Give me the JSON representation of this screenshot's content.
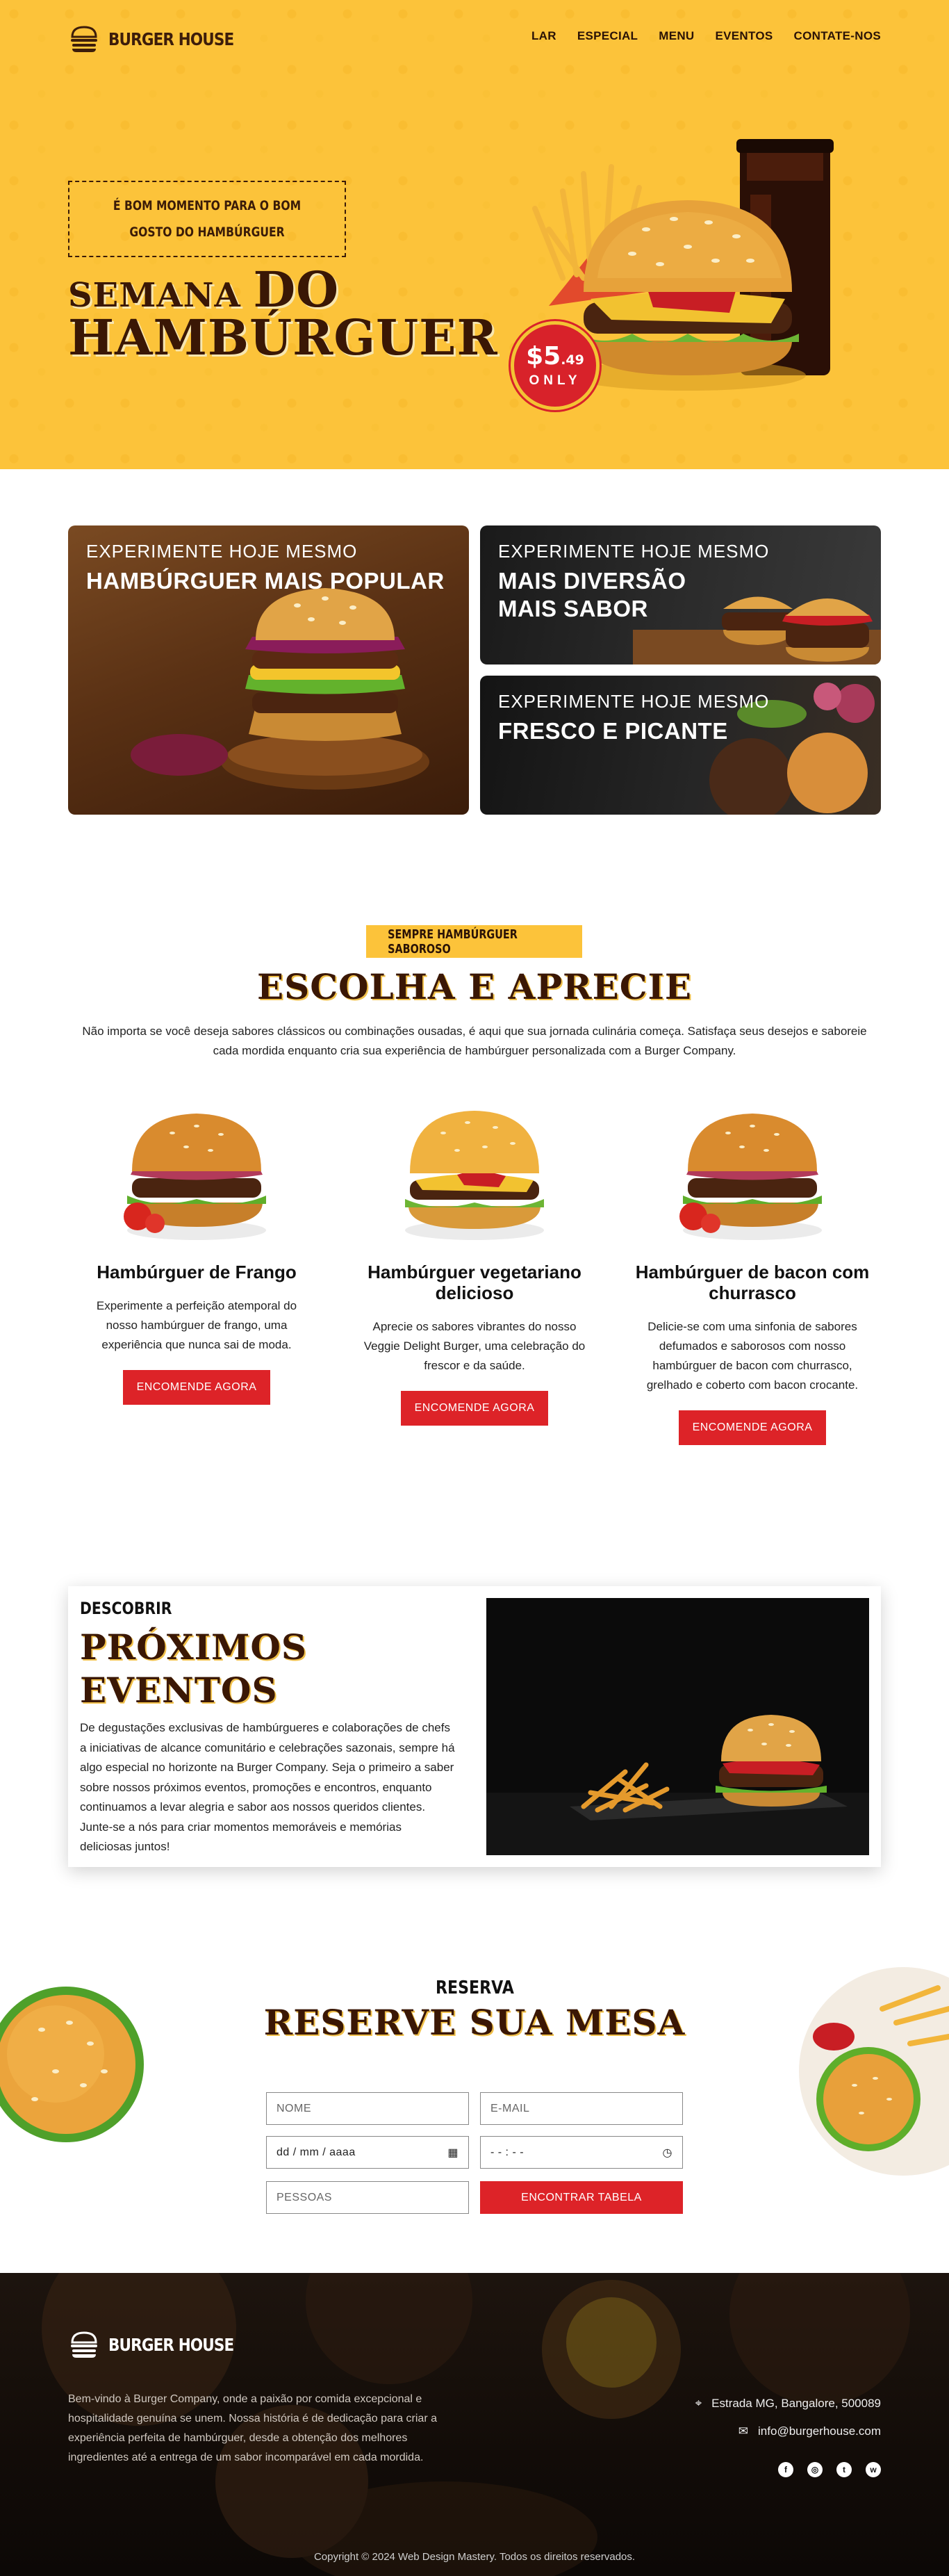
{
  "brand": {
    "name": "BURGER HOUSE"
  },
  "nav": {
    "items": [
      "LAR",
      "ESPECIAL",
      "MENU",
      "EVENTOS",
      "CONTATE-NOS"
    ]
  },
  "hero": {
    "tagline": "É BOM MOMENTO PARA O BOM GOSTO DO HAMBÚRGUER",
    "title_prefix": "SEMANA ",
    "title_do": "DO",
    "title_main": "HAMBÚRGUER",
    "price_main": "$5",
    "price_cents": ".49",
    "price_only": "ONLY"
  },
  "promos": [
    {
      "kicker": "EXPERIMENTE HOJE MESMO",
      "title": "HAMBÚRGUER MAIS POPULAR"
    },
    {
      "kicker": "EXPERIMENTE HOJE MESMO",
      "title": "MAIS DIVERSÃO MAIS SABOR"
    },
    {
      "kicker": "EXPERIMENTE HOJE MESMO",
      "title": "FRESCO E PICANTE"
    }
  ],
  "menu": {
    "badge": "SEMPRE HAMBÚRGUER SABOROSO",
    "title": "ESCOLHA E APRECIE",
    "description": "Não importa se você deseja sabores clássicos ou combinações ousadas, é aqui que sua jornada culinária começa. Satisfaça seus desejos e saboreie cada mordida enquanto cria sua experiência de hambúrguer personalizada com a Burger Company.",
    "products": [
      {
        "name": "Hambúrguer de Frango",
        "desc": "Experimente a perfeição atemporal do nosso hambúrguer de frango, uma experiência que nunca sai de moda.",
        "cta": "ENCOMENDE AGORA"
      },
      {
        "name": "Hambúrguer vegetariano delicioso",
        "desc": "Aprecie os sabores vibrantes do nosso Veggie Delight Burger, uma celebração do frescor e da saúde.",
        "cta": "ENCOMENDE AGORA"
      },
      {
        "name": "Hambúrguer de bacon com churrasco",
        "desc": "Delicie-se com uma sinfonia de sabores defumados e saborosos com nosso hambúrguer de bacon com churrasco, grelhado e coberto com bacon crocante.",
        "cta": "ENCOMENDE AGORA"
      }
    ]
  },
  "events": {
    "label": "DESCOBRIR",
    "title_line1": "PRÓXIMOS",
    "title_line2": "EVENTOS",
    "description": "De degustações exclusivas de hambúrgueres e colaborações de chefs a iniciativas de alcance comunitário e celebrações sazonais, sempre há algo especial no horizonte na Burger Company. Seja o primeiro a saber sobre nossos próximos eventos, promoções e encontros, enquanto continuamos a levar alegria e sabor aos nossos queridos clientes. Junte-se a nós para criar momentos memoráveis e memórias deliciosas juntos!"
  },
  "reservation": {
    "label": "RESERVA",
    "title": "RESERVE SUA MESA",
    "name_placeholder": "NOME",
    "email_placeholder": "E-MAIL",
    "date_placeholder": "dd / mm / aaaa",
    "time_placeholder": "- - : - -",
    "people_placeholder": "PESSOAS",
    "submit": "ENCONTRAR TABELA"
  },
  "footer": {
    "description": "Bem-vindo à Burger Company, onde a paixão por comida excepcional e hospitalidade genuína se unem. Nossa história é de dedicação para criar a experiência perfeita de hambúrguer, desde a obtenção dos melhores ingredientes até a entrega de um sabor incomparável em cada mordida.",
    "address": "Estrada MG, Bangalore, 500089",
    "email": "info@burgerhouse.com",
    "social": [
      "facebook-icon",
      "instagram-icon",
      "twitter-icon",
      "whatsapp-icon"
    ],
    "copyright": "Copyright © 2024 Web Design Mastery. Todos os direitos reservados."
  },
  "colors": {
    "yellow": "#fcc33a",
    "brown": "#3a1705",
    "red": "#dd2328",
    "dark": "#120c08"
  }
}
